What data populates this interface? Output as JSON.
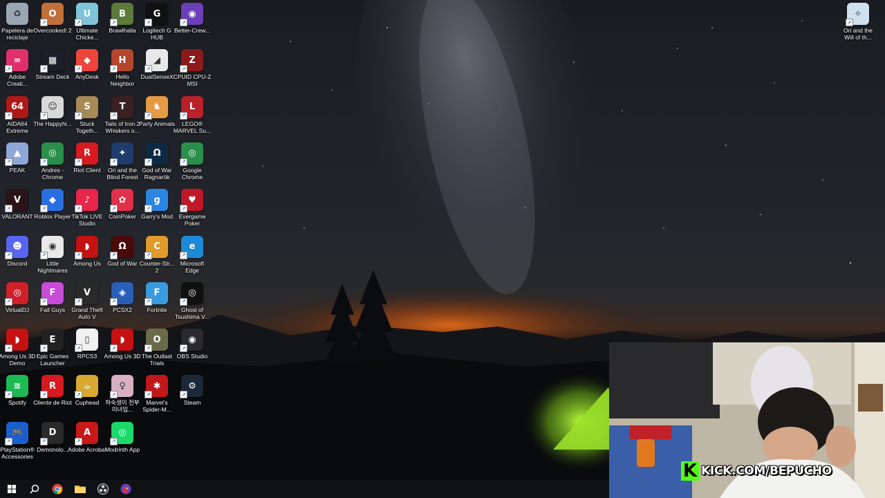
{
  "desktop": {
    "icons": [
      {
        "label": "Papelera de reciclaje",
        "icon": "recycle-bin-icon",
        "color": "#9aa6b2",
        "glyph": "♻"
      },
      {
        "label": "Overcooked! 2",
        "icon": "overcooked-icon",
        "color": "#c0703a",
        "glyph": "O"
      },
      {
        "label": "Ultimate Chicke...",
        "icon": "ultimate-chicken-horse-icon",
        "color": "#7fc4d8",
        "glyph": "U"
      },
      {
        "label": "Brawlhalla",
        "icon": "brawlhalla-icon",
        "color": "#5c7a3a",
        "glyph": "B"
      },
      {
        "label": "Logitech G HUB",
        "icon": "logitech-g-hub-icon",
        "color": "#111111",
        "glyph": "G"
      },
      {
        "label": "Better-Crew...",
        "icon": "better-crewlink-icon",
        "color": "#6b3fb8",
        "glyph": "◉"
      },
      {
        "label": "Adobe Creati...",
        "icon": "adobe-creative-cloud-icon",
        "color": "#e0306a",
        "glyph": "∞"
      },
      {
        "label": "Stream Deck",
        "icon": "stream-deck-icon",
        "color": "#1b1f2a",
        "glyph": "▦"
      },
      {
        "label": "AnyDesk",
        "icon": "anydesk-icon",
        "color": "#ef443b",
        "glyph": "◆"
      },
      {
        "label": "Hello Neighbor",
        "icon": "hello-neighbor-icon",
        "color": "#b5462c",
        "glyph": "H"
      },
      {
        "label": "DualSenseX",
        "icon": "dualsensex-icon",
        "color": "#e8e8e8",
        "glyph": "◢"
      },
      {
        "label": "CPUID CPU-Z MSI",
        "icon": "cpuz-icon",
        "color": "#8b1a1a",
        "glyph": "Z"
      },
      {
        "label": "AIDA64 Extreme",
        "icon": "aida64-icon",
        "color": "#b01818",
        "glyph": "64"
      },
      {
        "label": "The Happyhi...",
        "icon": "happyhills-icon",
        "color": "#d9d9d9",
        "glyph": "☺"
      },
      {
        "label": "Stuck Togeth...",
        "icon": "stuck-together-icon",
        "color": "#a68a55",
        "glyph": "S"
      },
      {
        "label": "Tails of Iron 2 Whiskers o...",
        "icon": "tails-of-iron-icon",
        "color": "#3a2020",
        "glyph": "T"
      },
      {
        "label": "Party Animals",
        "icon": "party-animals-icon",
        "color": "#e59a44",
        "glyph": "♞"
      },
      {
        "label": "LEGO® MARVEL Su...",
        "icon": "lego-marvel-icon",
        "color": "#b8202a",
        "glyph": "L"
      },
      {
        "label": "PEAK",
        "icon": "peak-icon",
        "color": "#8fa7d8",
        "glyph": "▲"
      },
      {
        "label": "Andres - Chrome",
        "icon": "chrome-profile-icon",
        "color": "#2a8f4a",
        "glyph": "◎"
      },
      {
        "label": "Riot Client",
        "icon": "riot-client-icon",
        "color": "#d71920",
        "glyph": "R"
      },
      {
        "label": "Ori and the Blind Forest",
        "icon": "ori-blind-forest-icon",
        "color": "#1e3d6b",
        "glyph": "✦"
      },
      {
        "label": "God of War Ragnarök",
        "icon": "god-of-war-ragnarok-icon",
        "color": "#0d2a44",
        "glyph": "Ω"
      },
      {
        "label": "Google Chrome",
        "icon": "google-chrome-icon",
        "color": "#2a8f4a",
        "glyph": "◎"
      },
      {
        "label": "VALORANT",
        "icon": "valorant-icon",
        "color": "#2a1418",
        "glyph": "V"
      },
      {
        "label": "Roblox Player",
        "icon": "roblox-icon",
        "color": "#2a6fe0",
        "glyph": "◆"
      },
      {
        "label": "TikTok LIVE Studio",
        "icon": "tiktok-live-icon",
        "color": "#e8254a",
        "glyph": "♪"
      },
      {
        "label": "CoinPoker",
        "icon": "coinpoker-icon",
        "color": "#e0304a",
        "glyph": "✿"
      },
      {
        "label": "Garry's Mod",
        "icon": "garrys-mod-icon",
        "color": "#2a86e0",
        "glyph": "g"
      },
      {
        "label": "Evergame Poker",
        "icon": "evergame-poker-icon",
        "color": "#c0182a",
        "glyph": "♥"
      },
      {
        "label": "Discord",
        "icon": "discord-icon",
        "color": "#5865f2",
        "glyph": "☻"
      },
      {
        "label": "Little Nightmares",
        "icon": "little-nightmares-icon",
        "color": "#e8e8e8",
        "glyph": "◉"
      },
      {
        "label": "Among Us",
        "icon": "among-us-icon",
        "color": "#c51111",
        "glyph": "◗"
      },
      {
        "label": "God of War",
        "icon": "god-of-war-icon",
        "color": "#4a0a0a",
        "glyph": "Ω"
      },
      {
        "label": "Counter-Str... 2",
        "icon": "counter-strike-2-icon",
        "color": "#e09a2a",
        "glyph": "C"
      },
      {
        "label": "Microsoft Edge",
        "icon": "microsoft-edge-icon",
        "color": "#1c8ad6",
        "glyph": "e"
      },
      {
        "label": "VirtualDJ",
        "icon": "virtualdj-icon",
        "color": "#d0202a",
        "glyph": "◎"
      },
      {
        "label": "Fall Guys",
        "icon": "fall-guys-icon",
        "color": "#c84cd8",
        "glyph": "F"
      },
      {
        "label": "Grand Theft Auto V",
        "icon": "gta-v-icon",
        "color": "#2a2a2a",
        "glyph": "V"
      },
      {
        "label": "PCSX2",
        "icon": "pcsx2-icon",
        "color": "#2a5fb8",
        "glyph": "◈"
      },
      {
        "label": "Fortnite",
        "icon": "fortnite-icon",
        "color": "#3a9ae0",
        "glyph": "F"
      },
      {
        "label": "Ghost of Tsushima V...",
        "icon": "ghost-of-tsushima-icon",
        "color": "#111111",
        "glyph": "◎"
      },
      {
        "label": "Among Us 3D Demo",
        "icon": "among-us-3d-demo-icon",
        "color": "#c51111",
        "glyph": "◗"
      },
      {
        "label": "Epic Games Launcher",
        "icon": "epic-games-icon",
        "color": "#222222",
        "glyph": "E"
      },
      {
        "label": "RPCS3",
        "icon": "rpcs3-icon",
        "color": "#f0f0f0",
        "glyph": "▯"
      },
      {
        "label": "Among Us 3D",
        "icon": "among-us-3d-icon",
        "color": "#c51111",
        "glyph": "◗"
      },
      {
        "label": "The Outlast Trials",
        "icon": "outlast-trials-icon",
        "color": "#6a6a4a",
        "glyph": "O"
      },
      {
        "label": "OBS Studio",
        "icon": "obs-studio-icon",
        "color": "#2a2a2e",
        "glyph": "◉"
      },
      {
        "label": "Spotify",
        "icon": "spotify-icon",
        "color": "#1db954",
        "glyph": "≋"
      },
      {
        "label": "Cliente de Riot",
        "icon": "riot-client-es-icon",
        "color": "#d71920",
        "glyph": "R"
      },
      {
        "label": "Cuphead",
        "icon": "cuphead-icon",
        "color": "#d8a830",
        "glyph": "☕"
      },
      {
        "label": "하숙생이 전부 미녀입...",
        "icon": "korean-game-icon",
        "color": "#d8b0c0",
        "glyph": "♀"
      },
      {
        "label": "Marvel's Spider-M...",
        "icon": "spider-man-icon",
        "color": "#c01818",
        "glyph": "✱"
      },
      {
        "label": "Steam",
        "icon": "steam-icon",
        "color": "#1b2838",
        "glyph": "⚙"
      },
      {
        "label": "PlayStation® Accessories",
        "icon": "playstation-accessories-icon",
        "color": "#1a5fd0",
        "glyph": "🎮"
      },
      {
        "label": "Demonolo...",
        "icon": "demonologist-icon",
        "color": "#2a2a2a",
        "glyph": "D"
      },
      {
        "label": "Adobe Acrobat",
        "icon": "adobe-acrobat-icon",
        "color": "#c81818",
        "glyph": "A"
      },
      {
        "label": "Modrinth App",
        "icon": "modrinth-icon",
        "color": "#1bd96a",
        "glyph": "◎"
      },
      {
        "label": "Ori and the Will of th...",
        "icon": "ori-will-wisps-icon",
        "color": "#cfe0ef",
        "glyph": "✧"
      }
    ]
  },
  "webcam": {
    "banner_text": "KICK.COM/BEPUCHO",
    "brand_letter": "K",
    "brand_color": "#53fc18"
  },
  "taskbar": {
    "buttons": [
      {
        "name": "start-button",
        "icon": "windows-start-icon"
      },
      {
        "name": "search-button",
        "icon": "search-icon"
      },
      {
        "name": "chrome-taskbar-button",
        "icon": "google-chrome-icon"
      },
      {
        "name": "file-explorer-taskbar-button",
        "icon": "folder-icon"
      },
      {
        "name": "obs-taskbar-button",
        "icon": "obs-studio-icon"
      },
      {
        "name": "better-crewlink-taskbar-button",
        "icon": "better-crewlink-icon"
      }
    ]
  }
}
